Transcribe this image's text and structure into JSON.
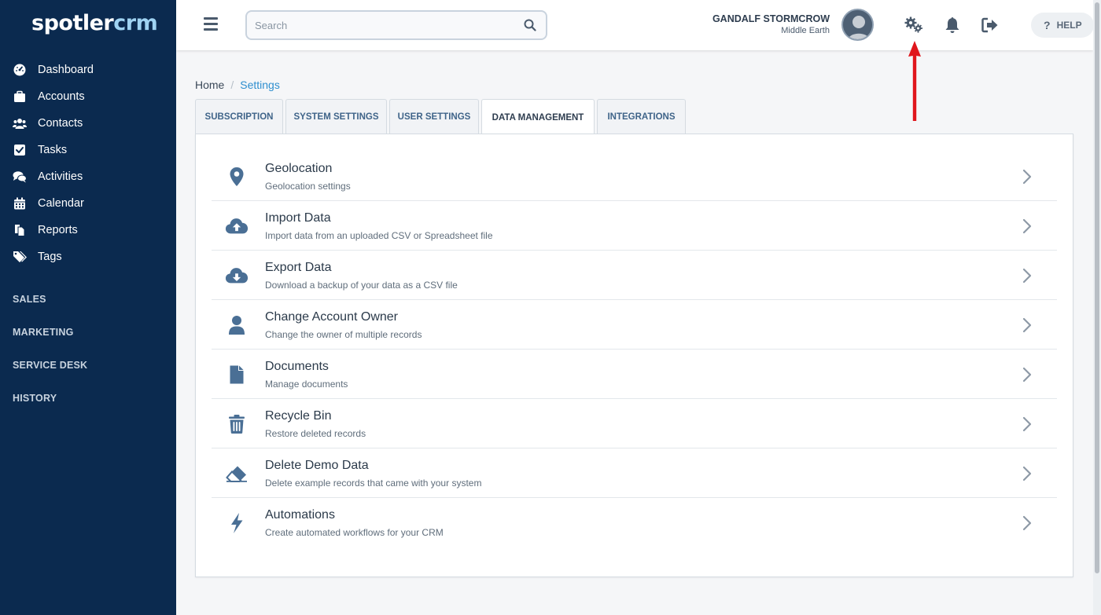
{
  "app": {
    "logo_main": "spotler",
    "logo_accent": "crm"
  },
  "sidebar": {
    "items": [
      {
        "label": "Dashboard",
        "icon": "dashboard-icon"
      },
      {
        "label": "Accounts",
        "icon": "briefcase-icon"
      },
      {
        "label": "Contacts",
        "icon": "users-icon"
      },
      {
        "label": "Tasks",
        "icon": "checkbox-icon"
      },
      {
        "label": "Activities",
        "icon": "chat-icon"
      },
      {
        "label": "Calendar",
        "icon": "calendar-icon"
      },
      {
        "label": "Reports",
        "icon": "reports-icon"
      },
      {
        "label": "Tags",
        "icon": "tags-icon"
      }
    ],
    "sections": [
      "SALES",
      "MARKETING",
      "SERVICE DESK",
      "HISTORY"
    ]
  },
  "topbar": {
    "search_placeholder": "Search",
    "user_name": "GANDALF STORMCROW",
    "user_location": "Middle Earth",
    "help_icon": "?",
    "help_label": "HELP"
  },
  "breadcrumb": {
    "home": "Home",
    "separator": "/",
    "current": "Settings"
  },
  "tabs": [
    {
      "label": "SUBSCRIPTION",
      "active": false
    },
    {
      "label": "SYSTEM SETTINGS",
      "active": false
    },
    {
      "label": "USER SETTINGS",
      "active": false
    },
    {
      "label": "DATA MANAGEMENT",
      "active": true
    },
    {
      "label": "INTEGRATIONS",
      "active": false
    }
  ],
  "settings": [
    {
      "title": "Geolocation",
      "description": "Geolocation settings",
      "icon": "map-pin-icon"
    },
    {
      "title": "Import Data",
      "description": "Import data from an uploaded CSV or Spreadsheet file",
      "icon": "cloud-upload-icon"
    },
    {
      "title": "Export Data",
      "description": "Download a backup of your data as a CSV file",
      "icon": "cloud-download-icon"
    },
    {
      "title": "Change Account Owner",
      "description": "Change the owner of multiple records",
      "icon": "user-icon"
    },
    {
      "title": "Documents",
      "description": "Manage documents",
      "icon": "document-icon"
    },
    {
      "title": "Recycle Bin",
      "description": "Restore deleted records",
      "icon": "trash-icon"
    },
    {
      "title": "Delete Demo Data",
      "description": "Delete example records that came with your system",
      "icon": "eraser-icon"
    },
    {
      "title": "Automations",
      "description": "Create automated workflows for your CRM",
      "icon": "bolt-icon"
    }
  ],
  "colors": {
    "sidebar_bg": "#0b2a4f",
    "icon_color": "#4a6f95",
    "accent_link": "#2f8fcf",
    "annotation_red": "#e0161c"
  }
}
